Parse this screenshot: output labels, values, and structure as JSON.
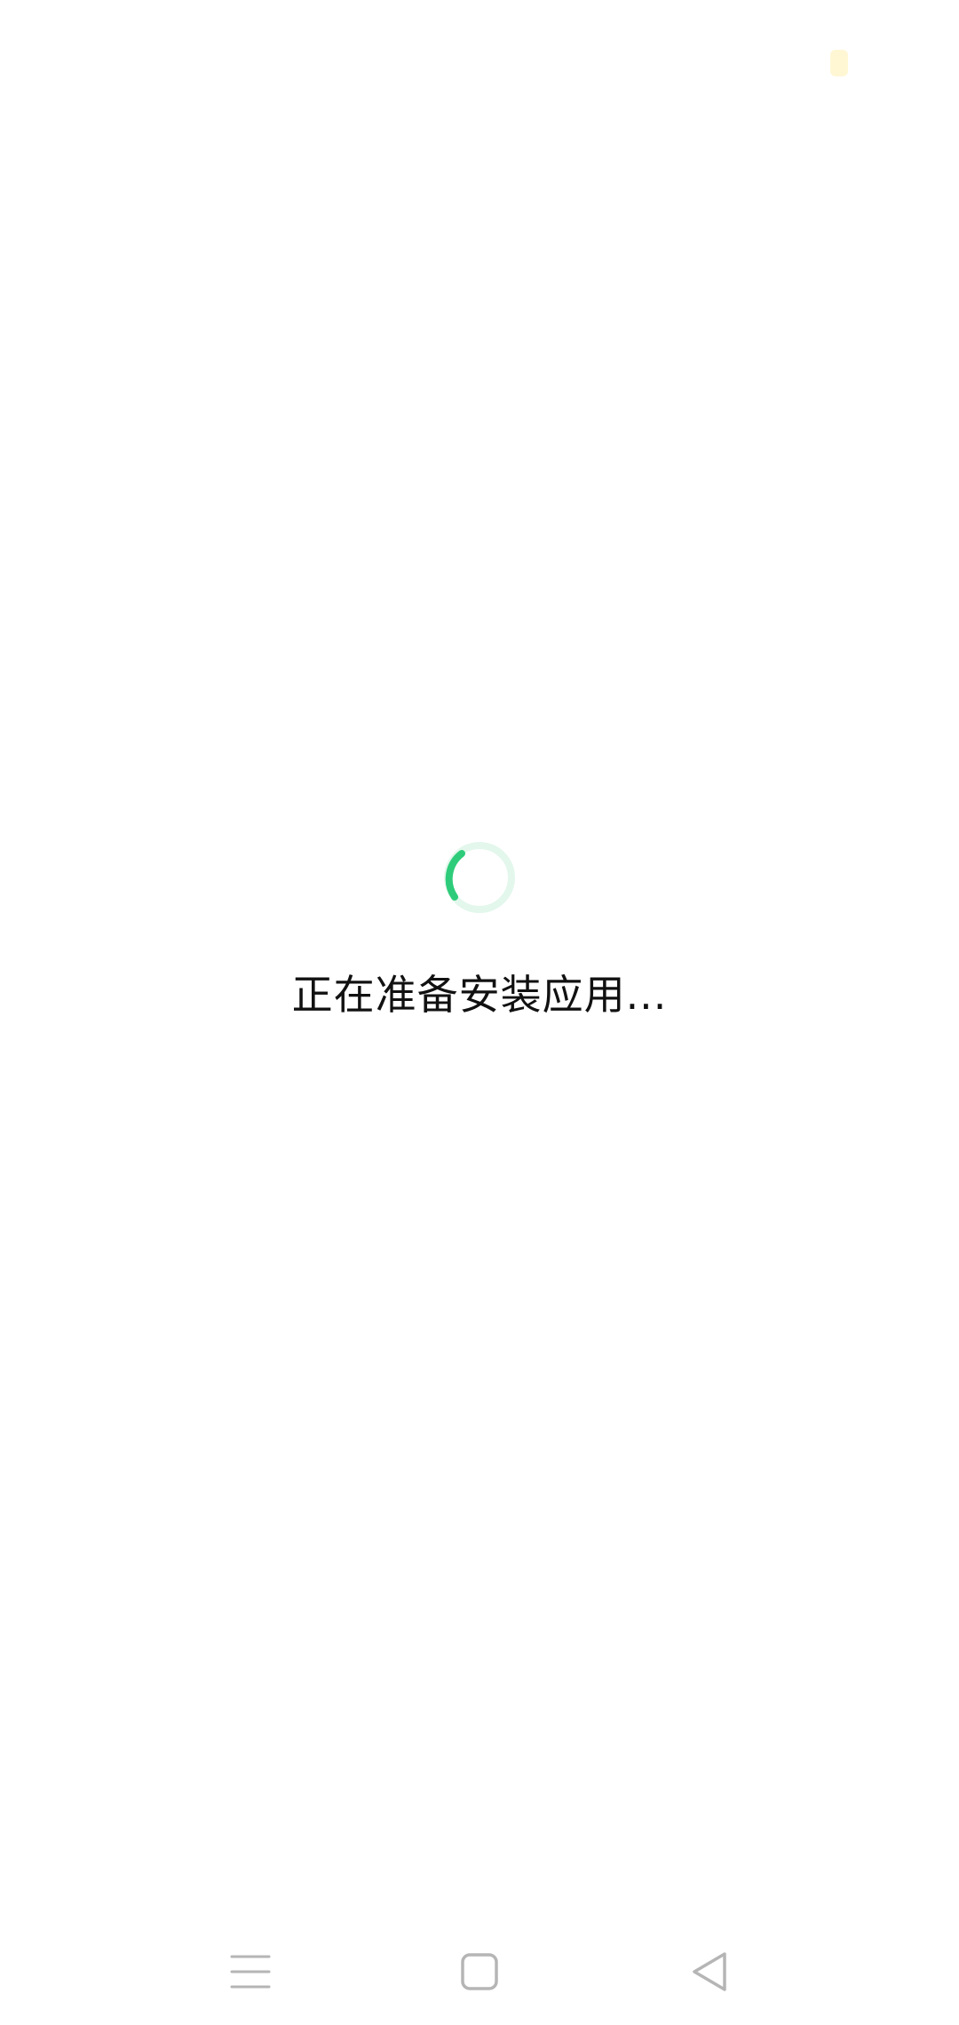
{
  "loading": {
    "message": "正在准备安装应用..."
  },
  "colors": {
    "spinner_active": "#2ecc7a",
    "spinner_track": "#e3f7ec",
    "nav_icon": "#b5b5b5",
    "status_indicator": "#fff6cf"
  },
  "navbar": {
    "menu_icon": "menu-lines-icon",
    "home_icon": "rounded-square-icon",
    "back_icon": "triangle-back-icon"
  }
}
